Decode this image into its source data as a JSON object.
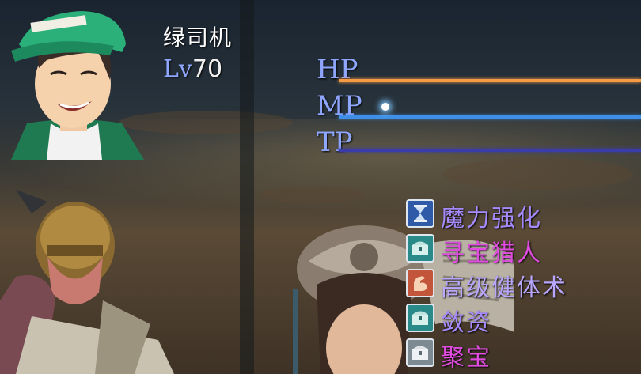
{
  "character": {
    "name": "绿司机",
    "level_prefix": "Lv",
    "level_value": "70"
  },
  "gauges": [
    {
      "label": "HP",
      "color": "#f39b45"
    },
    {
      "label": "MP",
      "color": "#3f8fe8"
    },
    {
      "label": "TP",
      "color": "#3a3ca8"
    }
  ],
  "skills": [
    {
      "name": "魔力强化",
      "color": "#a58bff",
      "icon": "hourglass-icon",
      "icon_bg": "#2e5aa8"
    },
    {
      "name": "寻宝猎人",
      "color": "#e04be0",
      "icon": "treasure-chest-icon",
      "icon_bg": "#2a8a8a"
    },
    {
      "name": "高级健体术",
      "color": "#b8a6ff",
      "icon": "flexed-arm-icon",
      "icon_bg": "#c2553a"
    },
    {
      "name": "敛资",
      "color": "#a58bff",
      "icon": "treasure-chest-icon",
      "icon_bg": "#2a8a8a"
    },
    {
      "name": "聚宝",
      "color": "#e04be0",
      "icon": "treasure-chest-icon",
      "icon_bg": "#7e8a92"
    }
  ]
}
